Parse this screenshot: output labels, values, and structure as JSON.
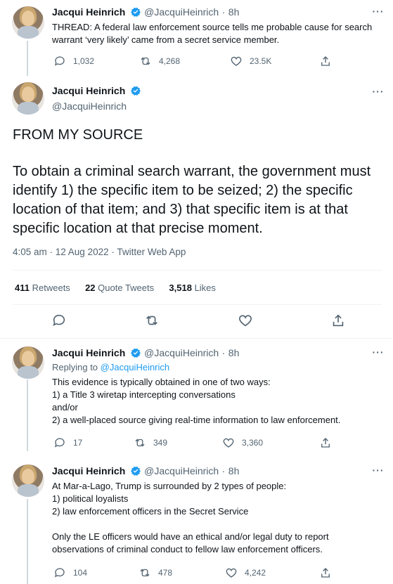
{
  "tweet1": {
    "name": "Jacqui Heinrich",
    "handle": "@JacquiHeinrich",
    "time": "8h",
    "text": "THREAD: A federal law enforcement source tells me probable cause for search warrant ‘very likely’ came from a secret service member.",
    "replies": "1,032",
    "retweets": "4,268",
    "likes": "23.5K"
  },
  "main": {
    "name": "Jacqui Heinrich",
    "handle": "@JacquiHeinrich",
    "heading": "FROM MY SOURCE",
    "body": "To obtain a criminal search warrant, the government must identify 1) the specific item to be seized; 2) the specific location of that item; and 3) that specific item is at that specific location at that precise moment.",
    "timestamp": "4:05 am · 12 Aug 2022 · Twitter Web App",
    "retweets_count": "411",
    "retweets_label": "Retweets",
    "quote_count": "22",
    "quote_label": "Quote Tweets",
    "likes_count": "3,518",
    "likes_label": "Likes"
  },
  "tweet3": {
    "name": "Jacqui Heinrich",
    "handle": "@JacquiHeinrich",
    "time": "8h",
    "replying_prefix": "Replying to",
    "replying_handle": "@JacquiHeinrich",
    "text": "This evidence is typically obtained in one of two ways:\n1) a Title 3 wiretap intercepting conversations\nand/or\n2) a well-placed source giving real-time information to law enforcement.",
    "replies": "17",
    "retweets": "349",
    "likes": "3,360"
  },
  "tweet4": {
    "name": "Jacqui Heinrich",
    "handle": "@JacquiHeinrich",
    "time": "8h",
    "text": "At Mar-a-Lago, Trump is surrounded by 2 types of people:\n1) political loyalists\n2) law enforcement officers in the Secret Service\n\nOnly the LE officers would have an ethical and/or legal duty to report observations of criminal conduct to fellow law enforcement officers.",
    "replies": "104",
    "retweets": "478",
    "likes": "4,242"
  },
  "colors": {
    "accent": "#1d9bf0",
    "muted": "#536471",
    "text": "#0f1419"
  }
}
